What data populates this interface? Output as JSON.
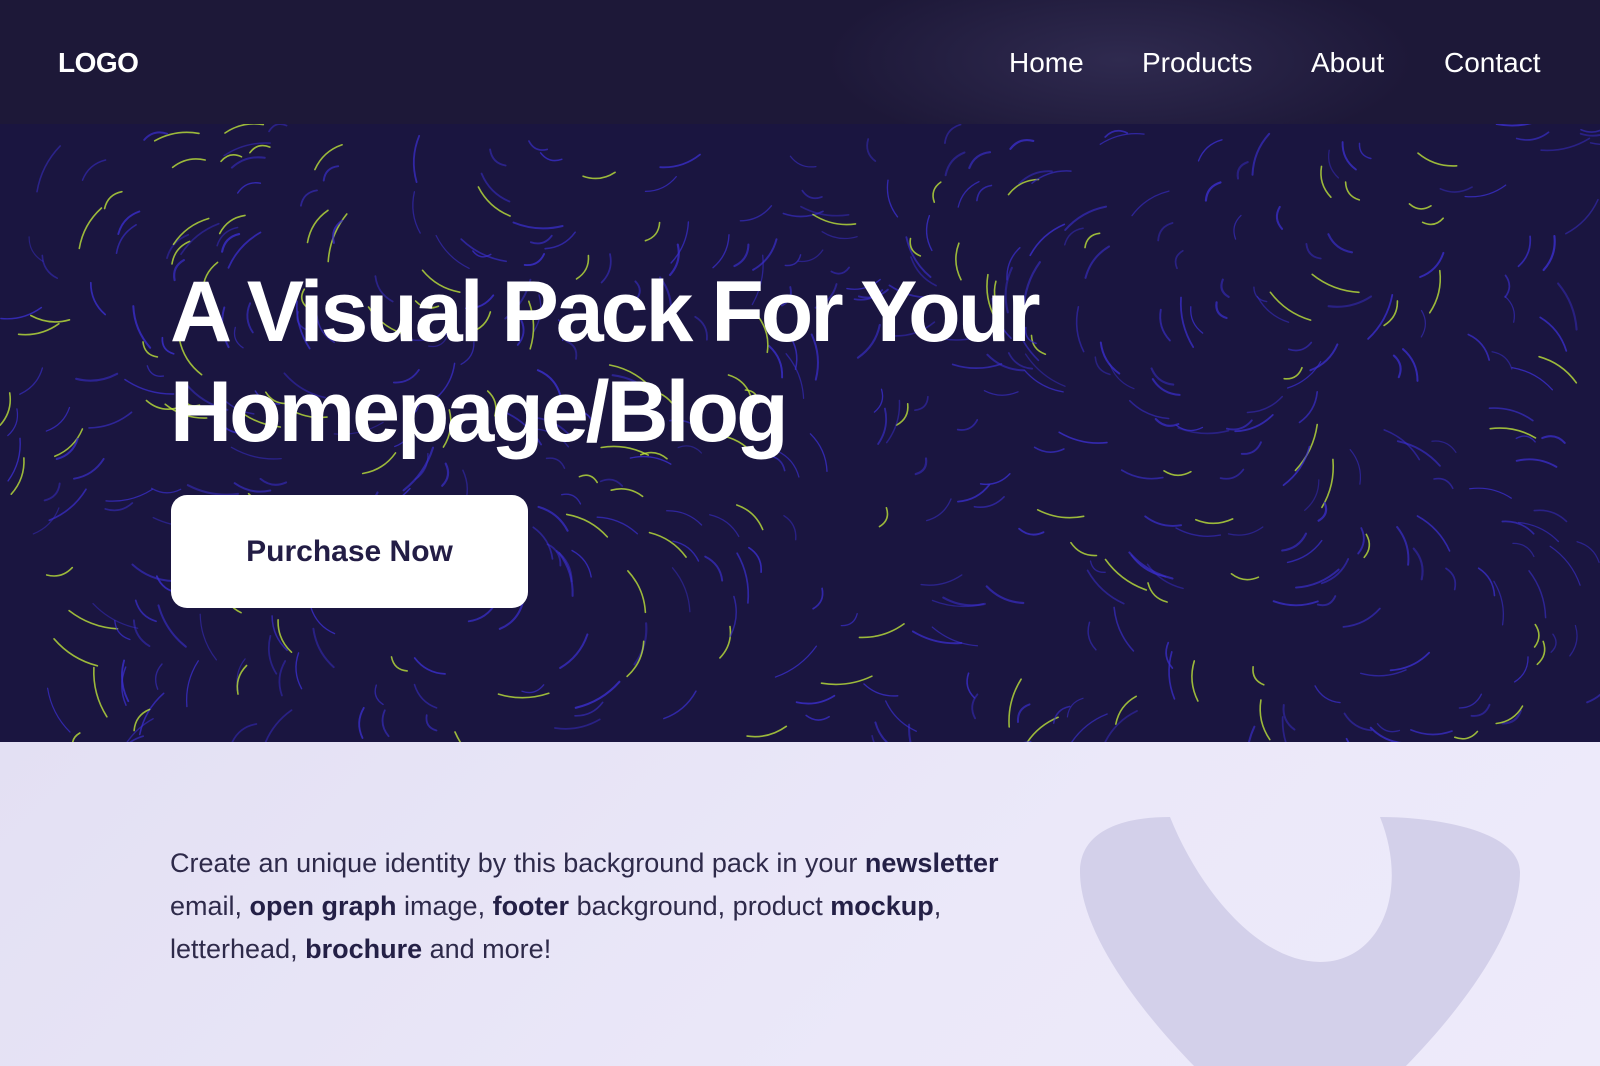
{
  "header": {
    "logo": "LOGO",
    "nav": {
      "home": "Home",
      "products": "Products",
      "about": "About",
      "contact": "Contact"
    }
  },
  "hero": {
    "title_line1": "A Visual Pack For Your",
    "title_line2": "Homepage/Blog",
    "cta_label": "Purchase Now"
  },
  "description": {
    "s1": "Create an unique identity by this background pack in your ",
    "b1": "newsletter",
    "s2": " email, ",
    "b2": "open graph",
    "s3": " image, ",
    "b3": "footer",
    "s4": " background, product ",
    "b4": "mockup",
    "s5": ", letterhead, ",
    "b5": "brochure",
    "s6": " and more!"
  },
  "colors": {
    "header_bg": "#1d1838",
    "hero_bg": "#1a1540",
    "swirl_blue": "#3b2fd0",
    "swirl_green": "#c8f03a",
    "lower_bg": "#ebe8f9",
    "deco_shape": "#d3d0ea",
    "cta_text": "#231d45"
  }
}
